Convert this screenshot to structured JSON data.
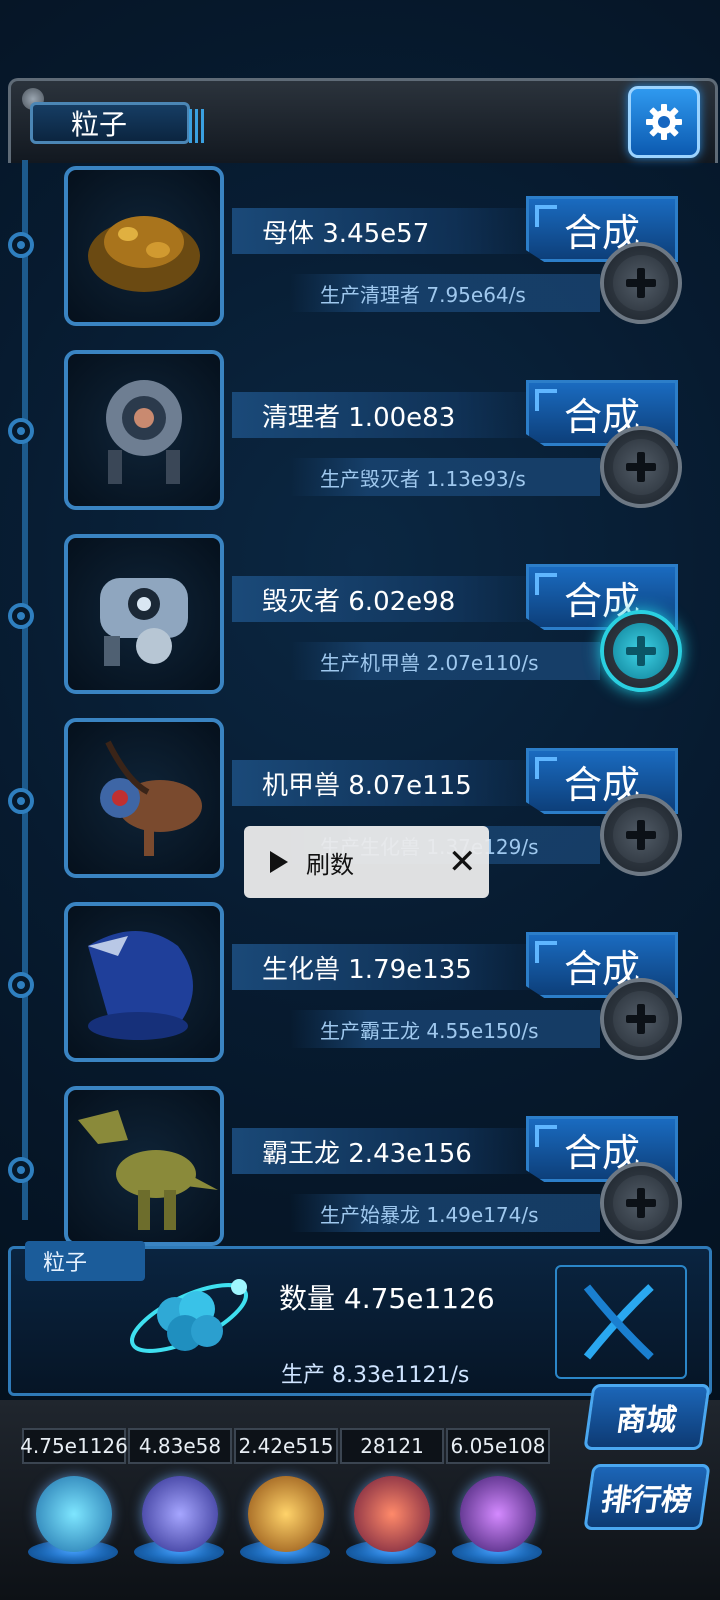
{
  "header": {
    "tab_label": "粒子",
    "settings_icon": "gear-icon"
  },
  "units": [
    {
      "name_line": "母体 3.45e57",
      "prod_line": "生产清理者 7.95e64/s",
      "merge_label": "合成",
      "plus_active": false
    },
    {
      "name_line": "清理者 1.00e83",
      "prod_line": "生产毁灭者 1.13e93/s",
      "merge_label": "合成",
      "plus_active": false
    },
    {
      "name_line": "毁灭者 6.02e98",
      "prod_line": "生产机甲兽 2.07e110/s",
      "merge_label": "合成",
      "plus_active": true
    },
    {
      "name_line": "机甲兽 8.07e115",
      "prod_line": "生产生化兽 1.37e129/s",
      "merge_label": "合成",
      "plus_active": false
    },
    {
      "name_line": "生化兽 1.79e135",
      "prod_line": "生产霸王龙 4.55e150/s",
      "merge_label": "合成",
      "plus_active": false
    },
    {
      "name_line": "霸王龙 2.43e156",
      "prod_line": "生产始暴龙 1.49e174/s",
      "merge_label": "合成",
      "plus_active": false
    }
  ],
  "ad_toast": {
    "label": "刷数"
  },
  "resource_panel": {
    "tab_label": "粒子",
    "count_line": "数量 4.75e1126",
    "prod_line": "生产 8.33e1121/s"
  },
  "currencies": [
    "4.75e1126",
    "4.83e58",
    "2.42e515",
    "28121",
    "6.05e108"
  ],
  "side_buttons": {
    "shop": "商城",
    "rank": "排行榜"
  },
  "colors": {
    "accent": "#1a6bc0",
    "active_plus": "#2ad0e0"
  }
}
